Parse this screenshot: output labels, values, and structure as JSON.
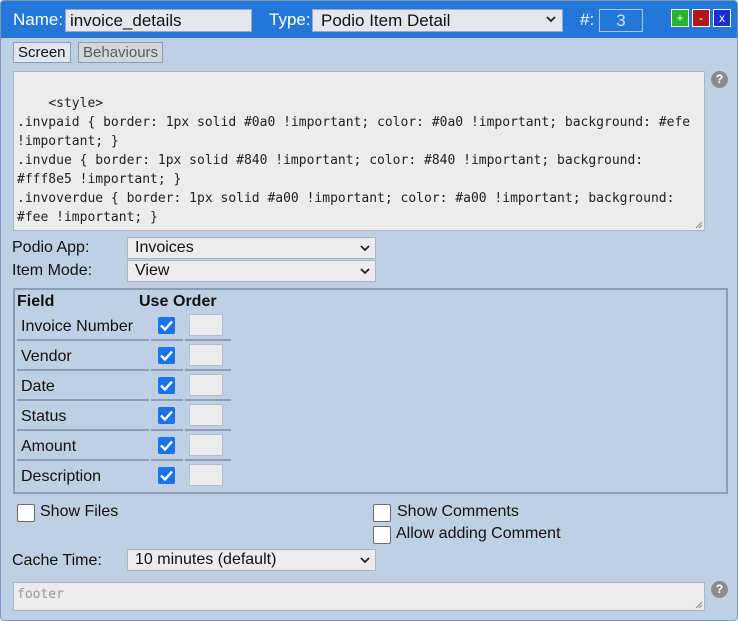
{
  "header": {
    "name_label": "Name:",
    "name_value": "invoice_details",
    "type_label": "Type:",
    "type_value": "Podio Item Detail",
    "num_label": "#:",
    "num_value": "3",
    "add_label": "+",
    "remove_label": "-",
    "close_label": "x",
    "colors": {
      "bar": "#2277d8",
      "add": "#2ab22a",
      "remove": "#b01818",
      "close": "#1a2fd0"
    }
  },
  "tabs": [
    {
      "label": "Screen",
      "active": true
    },
    {
      "label": "Behaviours",
      "active": false
    }
  ],
  "help_glyph": "?",
  "code": "<style>\n.invpaid { border: 1px solid #0a0 !important; color: #0a0 !important; background: #efe !important; }\n.invdue { border: 1px solid #840 !important; color: #840 !important; background: #fff8e5 !important; }\n.invoverdue { border: 1px solid #a00 !important; color: #a00 !important; background: #fee !important; }\n</style>",
  "podio_app": {
    "label": "Podio App:",
    "value": "Invoices"
  },
  "item_mode": {
    "label": "Item Mode:",
    "value": "View"
  },
  "fields_table": {
    "headers": [
      "Field",
      "Use",
      "Order"
    ],
    "rows": [
      {
        "field": "Invoice Number",
        "use": true,
        "order": ""
      },
      {
        "field": "Vendor",
        "use": true,
        "order": ""
      },
      {
        "field": "Date",
        "use": true,
        "order": ""
      },
      {
        "field": "Status",
        "use": true,
        "order": ""
      },
      {
        "field": "Amount",
        "use": true,
        "order": ""
      },
      {
        "field": "Description",
        "use": true,
        "order": ""
      }
    ]
  },
  "options": {
    "show_files": {
      "label": "Show Files",
      "checked": false
    },
    "show_comments": {
      "label": "Show Comments",
      "checked": false
    },
    "allow_adding_comment": {
      "label": "Allow adding Comment",
      "checked": false
    }
  },
  "cache_time": {
    "label": "Cache Time:",
    "value": "10 minutes (default)"
  },
  "footer": {
    "placeholder": "footer",
    "value": ""
  }
}
